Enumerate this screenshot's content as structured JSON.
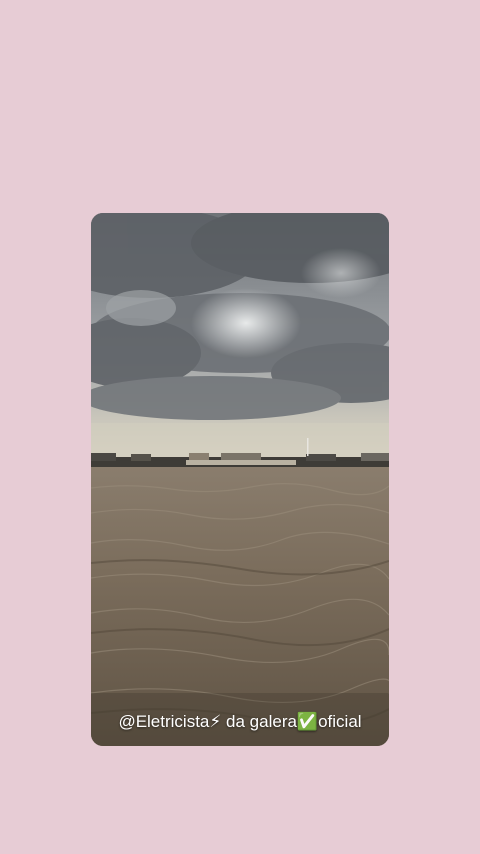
{
  "story": {
    "caption": "@Eletricista⚡ da galera✅oficial"
  },
  "colors": {
    "background": "#e7ccd5",
    "sky": "#8c8f93",
    "water": "#7a6a58"
  },
  "photo": {
    "subject": "storm-clouds-over-river"
  }
}
